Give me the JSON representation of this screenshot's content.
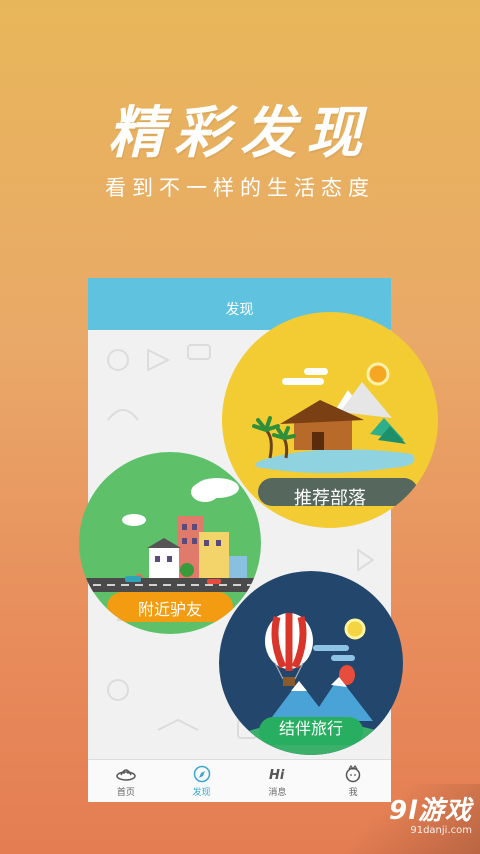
{
  "hero": {
    "title": "精彩发现",
    "subtitle": "看到不一样的生活态度"
  },
  "phone": {
    "title": "发现",
    "tabs": [
      {
        "label": "首页",
        "icon": "ufo-icon"
      },
      {
        "label": "发现",
        "icon": "compass-icon"
      },
      {
        "label": "消息",
        "icon": "hi-icon"
      },
      {
        "label": "我",
        "icon": "face-icon"
      }
    ]
  },
  "circles": {
    "tribe": {
      "label": "推荐部落"
    },
    "nearby": {
      "label": "附近驴友"
    },
    "travel": {
      "label": "结伴旅行"
    }
  },
  "brand": {
    "name": "9l游戏",
    "url": "91danji.com"
  },
  "colors": {
    "header": "#5fc3e0",
    "tribe": "#f2cc32",
    "nearby": "#5ec16a",
    "travel": "#22466c",
    "active_tab": "#3aa9cf"
  }
}
